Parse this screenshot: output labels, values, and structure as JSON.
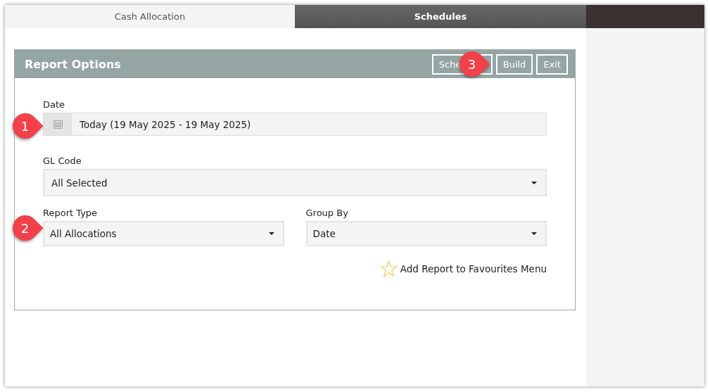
{
  "tabs": [
    {
      "label": "Cash Allocation",
      "selected": false
    },
    {
      "label": "Schedules",
      "selected": true
    }
  ],
  "panel": {
    "title": "Report Options",
    "buttons": [
      "Sche",
      "Build",
      "Exit"
    ]
  },
  "fields": [
    {
      "kind": "date",
      "label": "Date",
      "value": "Today (19 May 2025 - 19 May 2025)"
    },
    {
      "kind": "select",
      "label": "GL Code",
      "value": "All Selected"
    }
  ],
  "field_pair": [
    {
      "kind": "select",
      "label": "Report Type",
      "value": "All Allocations"
    },
    {
      "kind": "select",
      "label": "Group By",
      "value": "Date"
    }
  ],
  "favourite": {
    "label": "Add Report to Favourites Menu"
  },
  "callouts": [
    {
      "number": "1"
    },
    {
      "number": "2"
    },
    {
      "number": "3"
    }
  ]
}
